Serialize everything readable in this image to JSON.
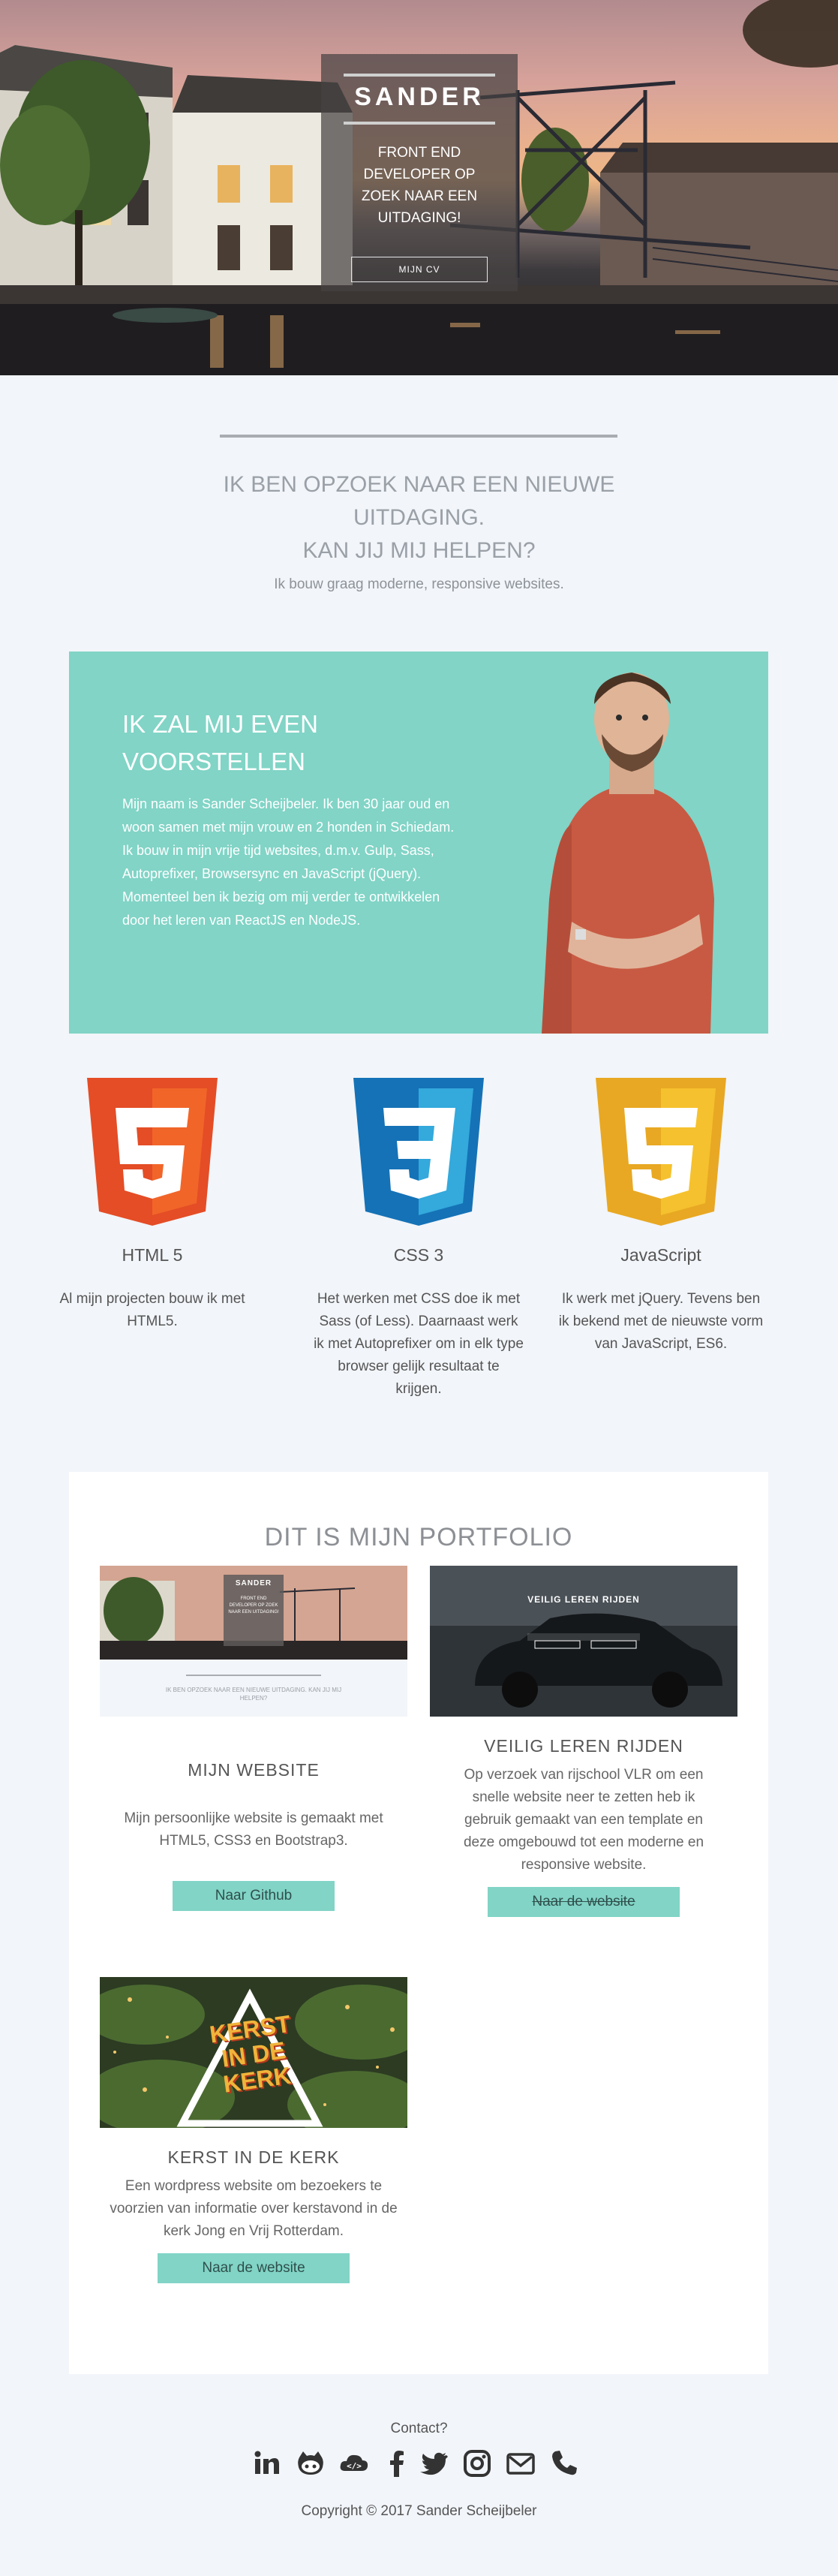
{
  "hero": {
    "name": "SANDER",
    "tagline": "FRONT END DEVELOPER OP ZOEK NAAR EEN UITDAGING!",
    "cv_button": "MIJN CV"
  },
  "intro": {
    "title_line1": "IK BEN OPZOEK NAAR EEN NIEUWE UITDAGING.",
    "title_line2": "KAN JIJ MIJ HELPEN?",
    "subtitle": "Ik bouw graag moderne, responsive websites."
  },
  "about": {
    "title": "IK ZAL MIJ EVEN VOORSTELLEN",
    "text": "Mijn naam is Sander Scheijbeler. Ik ben 30 jaar oud en woon samen met mijn vrouw en 2 honden in Schiedam. Ik bouw in mijn vrije tijd websites, d.m.v. Gulp, Sass, Autoprefixer, Browsersync en JavaScript (jQuery). Momenteel ben ik bezig om mij verder te ontwikkelen door het leren van ReactJS en NodeJS."
  },
  "skills": [
    {
      "name": "HTML 5",
      "badge": "5",
      "desc": "Al mijn projecten bouw ik met HTML5.",
      "color_dark": "#e44d26",
      "color_light": "#f16529",
      "icon": "html5-icon"
    },
    {
      "name": "CSS 3",
      "badge": "3",
      "desc": "Het werken met CSS doe ik met Sass (of Less). Daarnaast werk ik met Autoprefixer om in elk type browser gelijk resultaat te krijgen.",
      "color_dark": "#1572b6",
      "color_light": "#33a9dc",
      "icon": "css3-icon"
    },
    {
      "name": "JavaScript",
      "badge": "5",
      "desc": "Ik werk met jQuery. Tevens ben ik bekend met de nieuwste vorm van JavaScript, ES6.",
      "color_dark": "#e8a823",
      "color_light": "#f5c12e",
      "icon": "javascript-icon"
    }
  ],
  "portfolio": {
    "title": "DIT IS MIJN PORTFOLIO",
    "items": [
      {
        "name": "MIJN WEBSITE",
        "desc": "Mijn persoonlijke website is gemaakt met HTML5, CSS3 en Bootstrap3.",
        "button": "Naar Github",
        "button_strikethrough": false,
        "thumb_name": "SANDER",
        "thumb_tag": "FRONT END DEVELOPER OP ZOEK NAAR EEN UITDAGING!",
        "thumb_title": "IK BEN OPZOEK NAAR EEN NIEUWE UITDAGING. KAN JIJ MIJ HELPEN?"
      },
      {
        "name": "VEILIG LEREN RIJDEN",
        "desc": "Op verzoek van rijschool VLR om een snelle website neer te zetten heb ik gebruik gemaakt van een template en deze omgebouwd tot een moderne en responsive website.",
        "button": "Naar de website",
        "button_strikethrough": true,
        "thumb_title": "VEILIG LEREN RIJDEN",
        "thumb_sub": "VEILIG LEREN RIJDEN"
      },
      {
        "name": "KERST IN DE KERK",
        "desc": "Een wordpress website om bezoekers te voorzien van informatie over kerstavond in de kerk Jong en Vrij Rotterdam.",
        "button": "Naar de website",
        "button_strikethrough": false,
        "thumb_logo_line1": "KERST",
        "thumb_logo_line2": "IN DE",
        "thumb_logo_line3": "KERK"
      }
    ]
  },
  "footer": {
    "contact_label": "Contact?",
    "icons": [
      "linkedin-icon",
      "github-icon",
      "codepen-icon",
      "facebook-icon",
      "twitter-icon",
      "instagram-icon",
      "email-icon",
      "phone-icon"
    ],
    "copyright": "Copyright © 2017 Sander Scheijbeler"
  },
  "colors": {
    "accent": "#81d4c6",
    "background": "#f2f5f9",
    "text": "#555555"
  }
}
